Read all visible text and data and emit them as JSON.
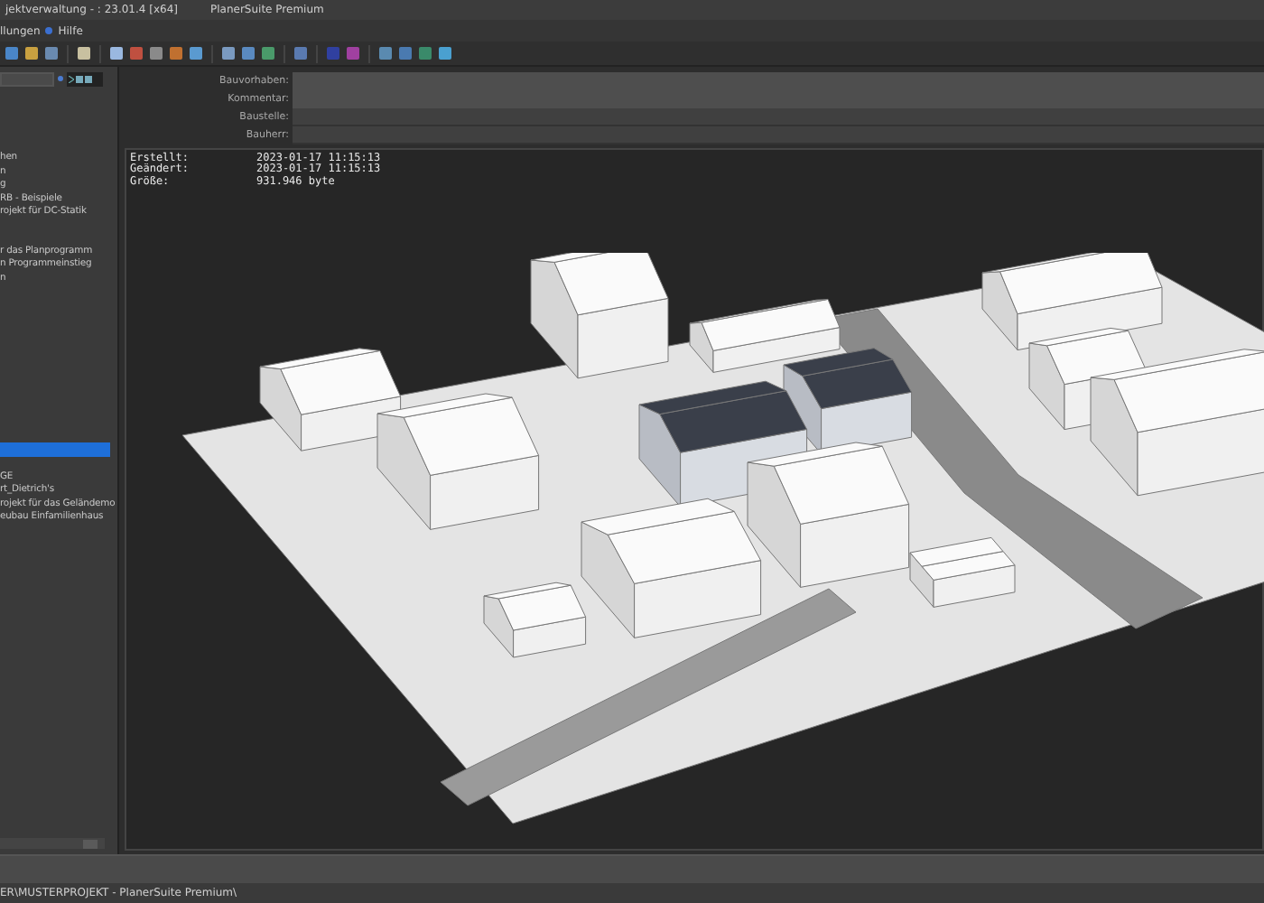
{
  "window": {
    "title": "jektverwaltung - : 23.01.4 [x64]",
    "app_name": "PlanerSuite Premium"
  },
  "menu": [
    "llungen",
    "Hilfe"
  ],
  "sidebar": {
    "groups": [
      {
        "items": [
          {
            "label": "hen",
            "selected": false
          },
          {
            "label": "n",
            "selected": false
          },
          {
            "label": "g",
            "selected": false
          },
          {
            "label": "RB - Beispiele",
            "selected": false
          },
          {
            "label": "rojekt für DC-Statik",
            "selected": false
          }
        ]
      },
      {
        "items": [
          {
            "label": "r das Planprogramm",
            "selected": false
          },
          {
            "label": "n Programmeinstieg",
            "selected": false
          },
          {
            "label": "n",
            "selected": false
          }
        ]
      },
      {
        "items": [
          {
            "selected": true
          }
        ]
      },
      {
        "items": [
          {
            "label": "GE",
            "selected": false
          },
          {
            "label": "rt_Dietrich's",
            "selected": false
          },
          {
            "label": "rojekt für das Geländemo",
            "selected": false
          },
          {
            "label": "eubau Einfamilienhaus",
            "selected": false
          }
        ]
      }
    ]
  },
  "fields": [
    {
      "label": "Bauvorhaben:",
      "kind": "large"
    },
    {
      "label": "Kommentar:",
      "kind": "large"
    },
    {
      "label": "Baustelle:",
      "kind": "small"
    },
    {
      "label": "Bauherr:",
      "kind": "small"
    }
  ],
  "info": [
    {
      "key": "Erstellt:",
      "value": "2023-01-17 11:15:13"
    },
    {
      "key": "Geändert:",
      "value": "2023-01-17 11:15:13"
    },
    {
      "key": "Größe:",
      "value": "931.946 byte"
    }
  ],
  "status_bar": "ER\\MUSTERPROJEKT - PlanerSuite Premium\\"
}
